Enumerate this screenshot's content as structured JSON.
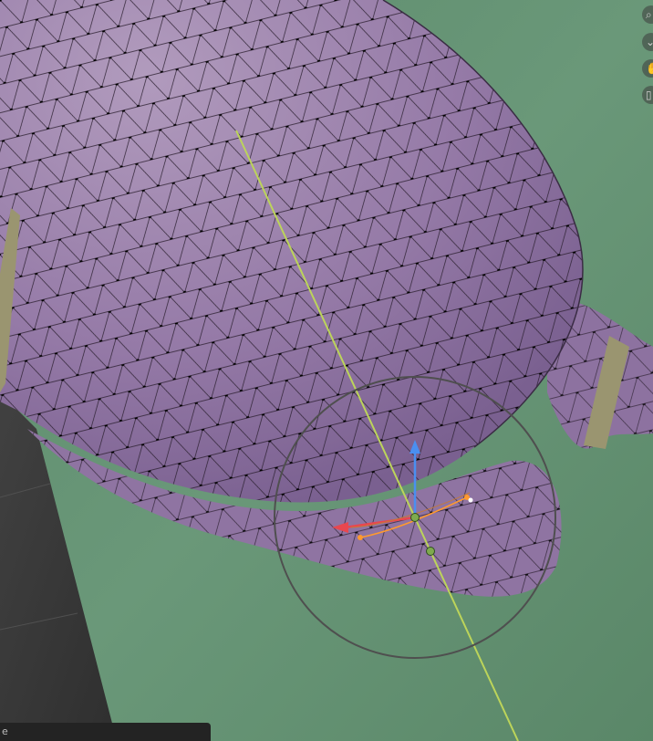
{
  "viewport": {
    "background_color": "#5f8e6e",
    "mesh_color": "#9b7fac",
    "floor_color": "#3a3a3a",
    "selection_line_color": "#bcd45a",
    "gizmo_axis_colors": {
      "x": "#e8474f",
      "z": "#4a8ff0",
      "handle": "#ff9a2e"
    }
  },
  "navigation_gizmo": {
    "buttons": [
      {
        "icon": "zoom-icon",
        "glyph": "⌕"
      },
      {
        "icon": "view-menu-icon",
        "glyph": "⌄"
      },
      {
        "icon": "pan-hand-icon",
        "glyph": "✋"
      },
      {
        "icon": "camera-icon",
        "glyph": "▯"
      }
    ]
  },
  "status_bar": {
    "text": "e"
  }
}
